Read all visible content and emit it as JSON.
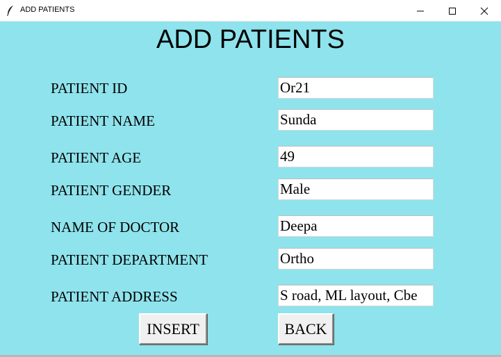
{
  "window": {
    "title": "ADD PATIENTS",
    "icon": "feather-icon",
    "controls": [
      "minimize-icon",
      "maximize-icon",
      "close-icon"
    ]
  },
  "form": {
    "heading": "ADD PATIENTS",
    "fields": [
      {
        "label": "PATIENT ID",
        "value": "Or21"
      },
      {
        "label": "PATIENT NAME",
        "value": "Sunda"
      },
      {
        "label": "PATIENT AGE",
        "value": "49"
      },
      {
        "label": "PATIENT GENDER",
        "value": "Male"
      },
      {
        "label": "NAME OF DOCTOR",
        "value": "Deepa"
      },
      {
        "label": "PATIENT DEPARTMENT",
        "value": "Ortho"
      },
      {
        "label": "PATIENT ADDRESS",
        "value": "S road, ML layout, Cbe"
      }
    ],
    "buttons": {
      "insert": "INSERT",
      "back": "BACK"
    }
  },
  "colors": {
    "background": "#8fe3ec",
    "entry": "#ffffff",
    "button": "#f0f0f0"
  }
}
